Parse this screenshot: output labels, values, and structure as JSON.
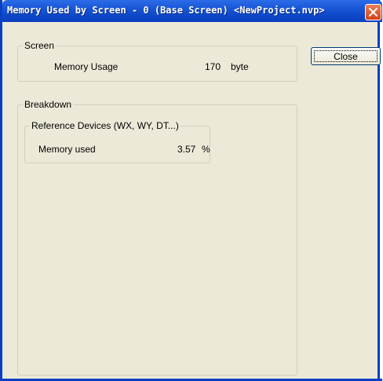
{
  "window": {
    "title": "Memory Used by Screen - 0 (Base Screen) <NewProject.nvp>"
  },
  "screen_group": {
    "label": "Screen",
    "memory_usage_label": "Memory Usage",
    "memory_usage_value": "170",
    "memory_usage_unit": "byte"
  },
  "close_button": {
    "label": "Close"
  },
  "breakdown_group": {
    "label": "Breakdown",
    "reference_devices": {
      "label": "Reference Devices (WX, WY, DT...)",
      "memory_used_label": "Memory used",
      "memory_used_value": "3.57",
      "memory_used_unit": "%"
    }
  },
  "icons": {
    "close": "close-x-icon"
  }
}
